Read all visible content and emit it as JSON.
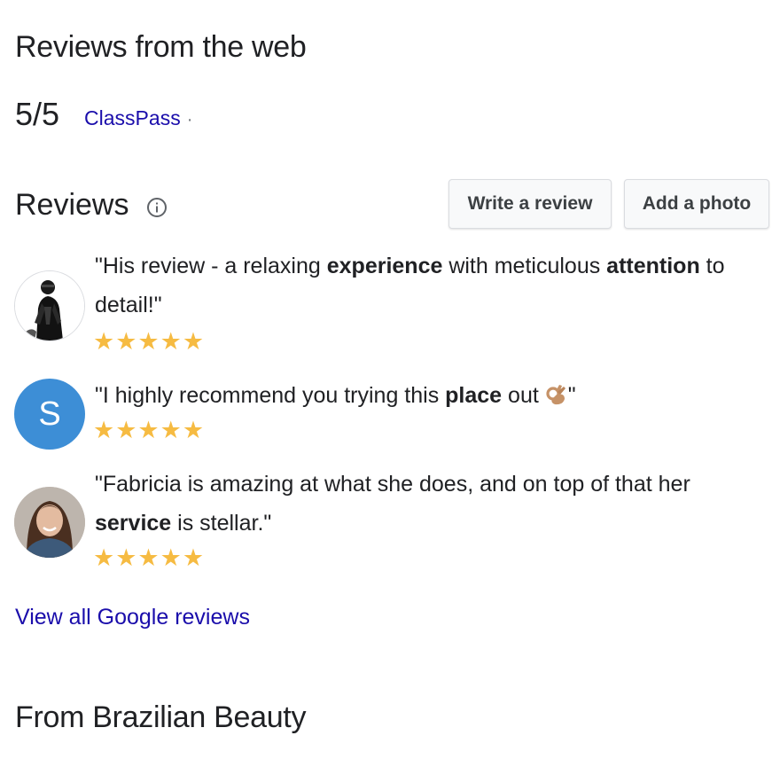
{
  "web_reviews": {
    "title": "Reviews from the web",
    "score": "5/5",
    "source": "ClassPass",
    "separator": "·"
  },
  "reviews": {
    "title": "Reviews",
    "write_review_label": "Write a review",
    "add_photo_label": "Add a photo",
    "items": [
      {
        "text_parts": [
          "\"His review - a relaxing ",
          "experience",
          " with meticulous ",
          "attention",
          " to detail!\""
        ],
        "stars": "★★★★★",
        "rating": 5,
        "avatar_icon": "user-photo-icon"
      },
      {
        "text_parts": [
          "\"I highly recommend you trying this ",
          "place",
          " out ",
          "\""
        ],
        "stars": "★★★★★",
        "rating": 5,
        "avatar_letter": "S",
        "avatar_color": "#3d8ed6",
        "emoji_icon": "ok-hand-emoji-icon"
      },
      {
        "text_parts": [
          "\"Fabricia is amazing at what she does, and on top of that her ",
          "service",
          " is stellar.\""
        ],
        "stars": "★★★★★",
        "rating": 5,
        "avatar_icon": "user-photo-icon"
      }
    ],
    "view_all_label": "View all Google reviews"
  },
  "brand_section": {
    "title": "From Brazilian Beauty"
  },
  "colors": {
    "link": "#1a0dab",
    "star": "#f6bb42",
    "text": "#202124"
  }
}
